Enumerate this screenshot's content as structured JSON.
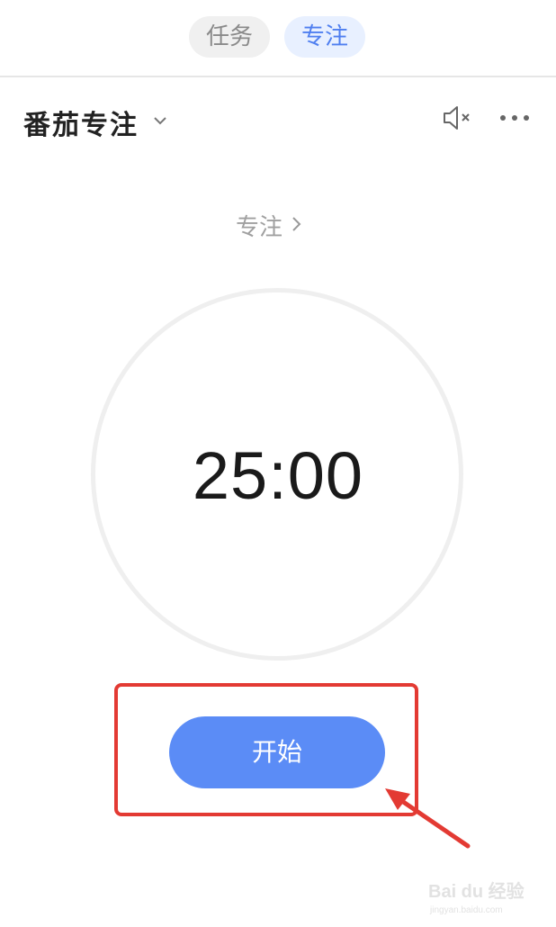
{
  "tabs": [
    {
      "label": "任务",
      "selected": false
    },
    {
      "label": "专注",
      "selected": true
    }
  ],
  "header": {
    "title": "番茄专注",
    "icons": [
      "chevron-down-icon",
      "mute-icon",
      "more-icon"
    ]
  },
  "mode": {
    "label": "专注"
  },
  "timer": {
    "value": "25:00"
  },
  "start_button": {
    "label": "开始"
  },
  "colors": {
    "accent": "#5b8cf6",
    "tab_selected_bg": "#e8f0ff",
    "tab_selected_text": "#4f7ff0",
    "annotation_red": "#e33a33"
  },
  "watermark": {
    "brand": "Bai du 经验",
    "sub": "jingyan.baidu.com"
  }
}
